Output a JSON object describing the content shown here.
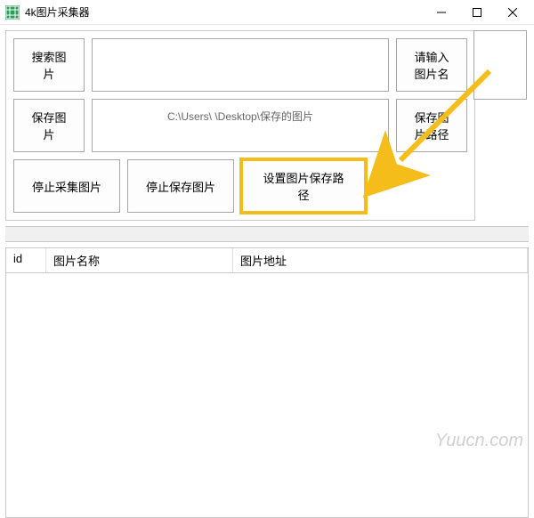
{
  "window": {
    "title": "4k图片采集器"
  },
  "toolbar": {
    "search_btn": "搜索图片",
    "name_btn": "请输入图片名",
    "save_btn": "保存图片",
    "path_value": "C:\\Users\\    \\Desktop\\保存的图片",
    "path_btn": "保存图片路径",
    "stop_collect": "停止采集图片",
    "stop_save": "停止保存图片",
    "set_path": "设置图片保存路径",
    "search_value": ""
  },
  "table": {
    "columns": {
      "id": "id",
      "name": "图片名称",
      "url": "图片地址"
    },
    "rows": []
  },
  "watermark": "Yuucn.com"
}
